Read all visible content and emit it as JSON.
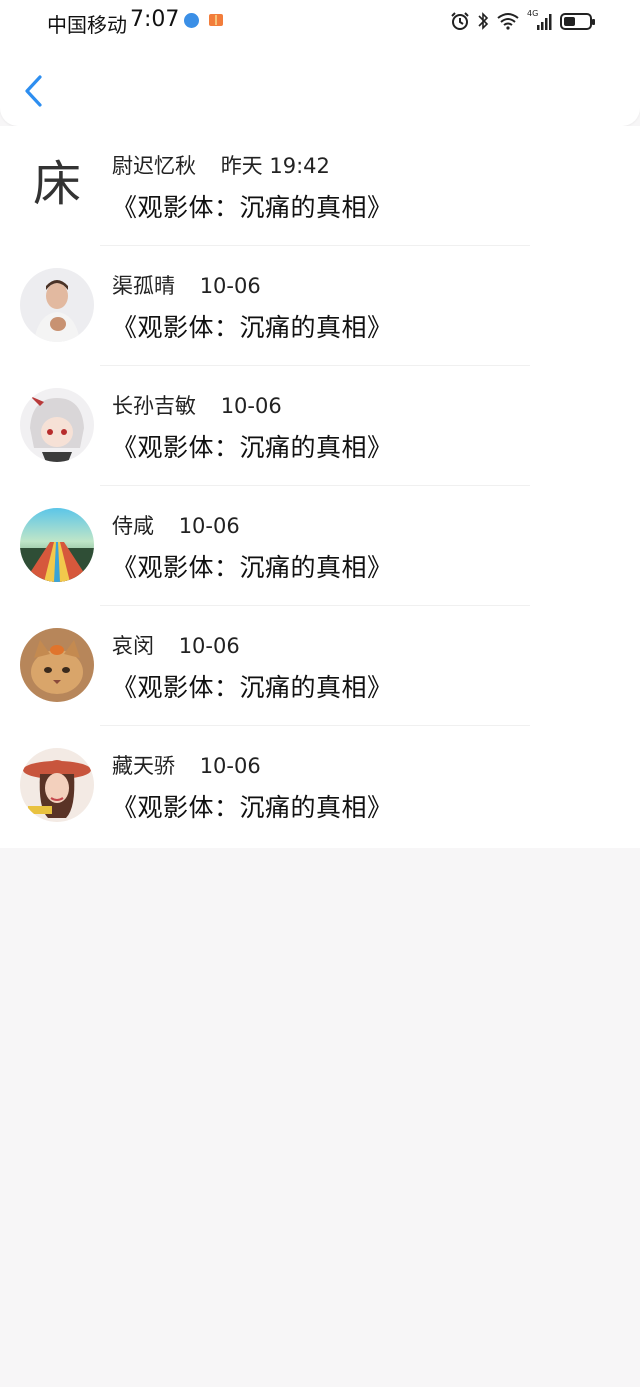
{
  "status_bar": {
    "carrier": "中国移动",
    "time": "7:07",
    "network": "4G"
  },
  "rows": [
    {
      "name": "尉迟忆秋",
      "time": "昨天 19:42",
      "message": "《观影体：沉痛的真相》",
      "avatar_text": "床"
    },
    {
      "name": "渠孤晴",
      "time": "10-06",
      "message": "《观影体：沉痛的真相》"
    },
    {
      "name": "长孙吉敏",
      "time": "10-06",
      "message": "《观影体：沉痛的真相》"
    },
    {
      "name": "侍咸",
      "time": "10-06",
      "message": "《观影体：沉痛的真相》"
    },
    {
      "name": "哀闵",
      "time": "10-06",
      "message": "《观影体：沉痛的真相》"
    },
    {
      "name": "藏天骄",
      "time": "10-06",
      "message": "《观影体：沉痛的真相》"
    }
  ],
  "colors": {
    "accent": "#2d8ef0",
    "background": "#f7f6f7",
    "list_background": "#ffffff"
  }
}
